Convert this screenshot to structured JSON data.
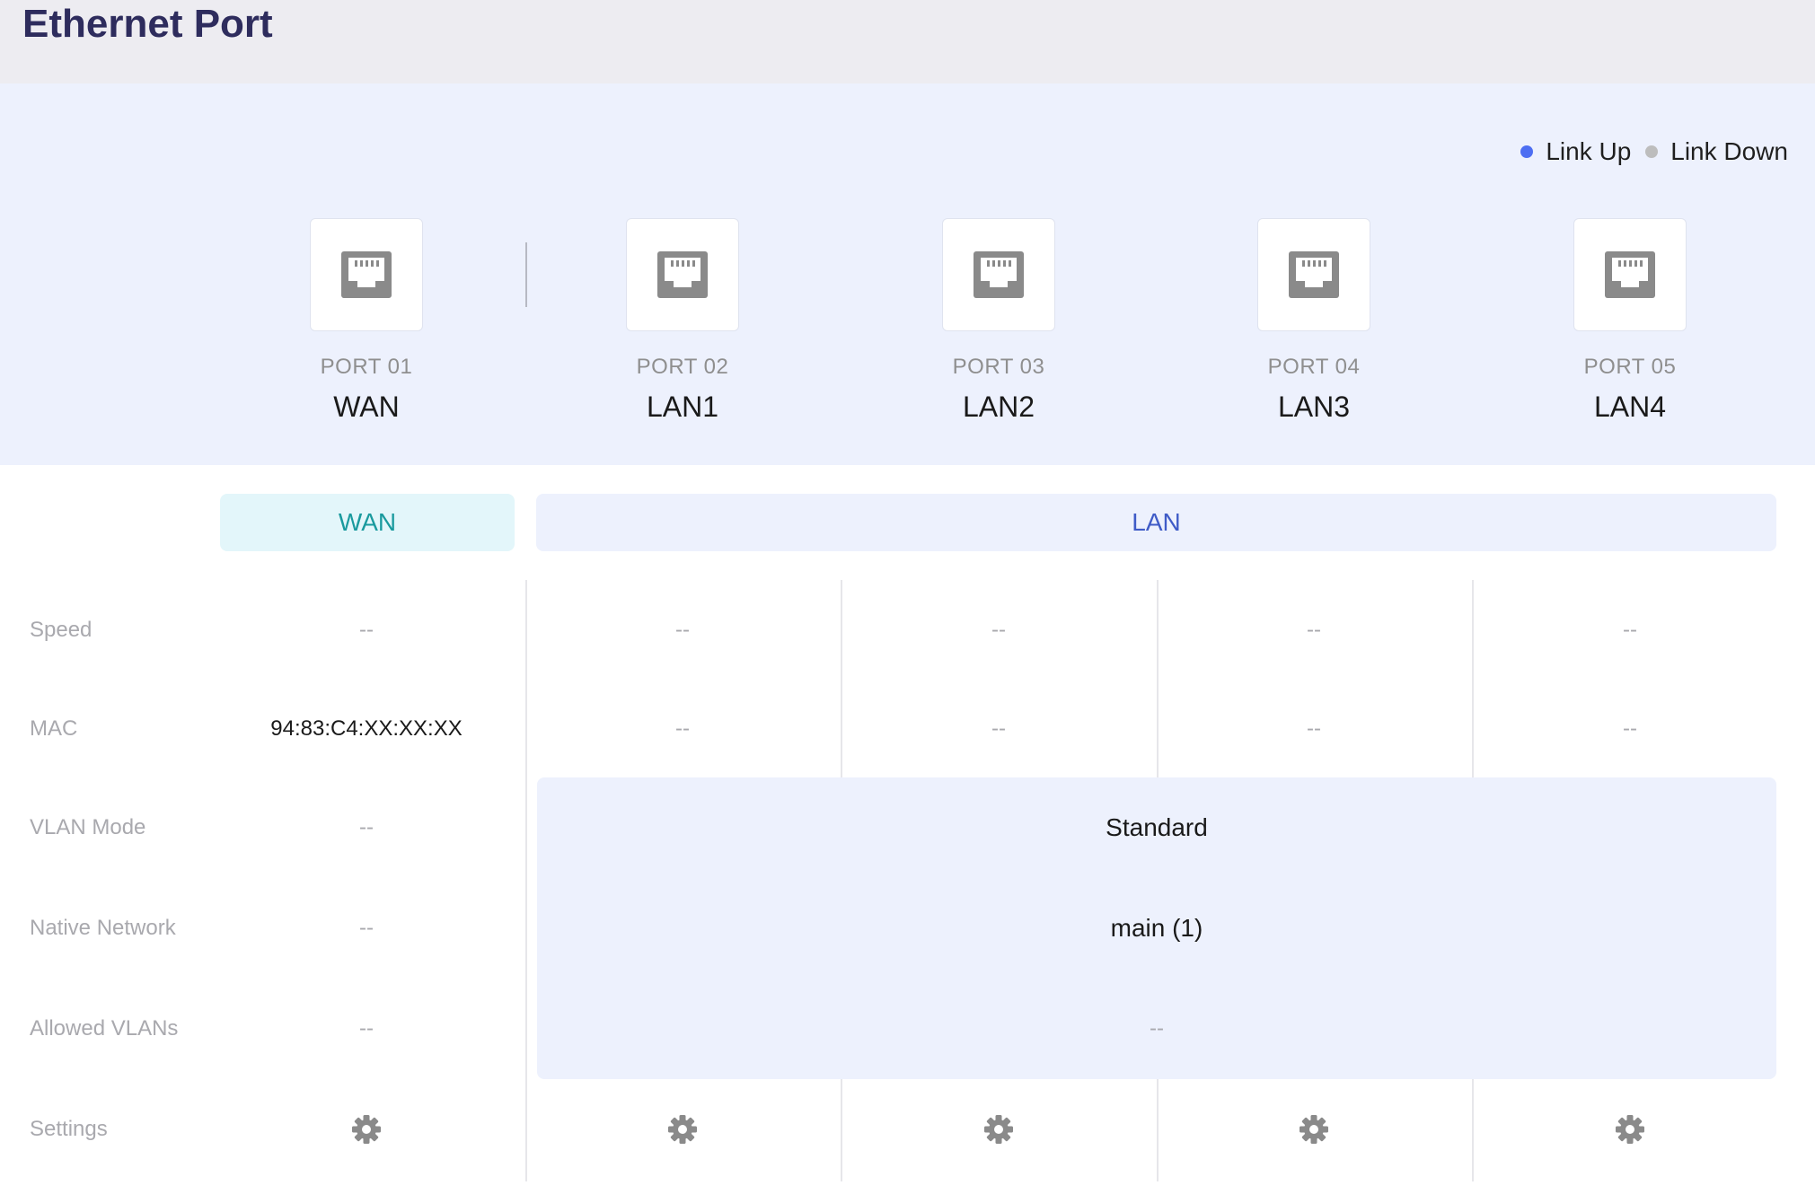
{
  "header": {
    "title": "Ethernet Port"
  },
  "legend": {
    "link_up": {
      "label": "Link Up",
      "color": "#4d6ef2"
    },
    "link_down": {
      "label": "Link Down",
      "color": "#bdbdbd"
    }
  },
  "ports": [
    {
      "number": "PORT 01",
      "name": "WAN",
      "icon": "ethernet-port-icon",
      "status": "down"
    },
    {
      "number": "PORT 02",
      "name": "LAN1",
      "icon": "ethernet-port-icon",
      "status": "down"
    },
    {
      "number": "PORT 03",
      "name": "LAN2",
      "icon": "ethernet-port-icon",
      "status": "down"
    },
    {
      "number": "PORT 04",
      "name": "LAN3",
      "icon": "ethernet-port-icon",
      "status": "down"
    },
    {
      "number": "PORT 05",
      "name": "LAN4",
      "icon": "ethernet-port-icon",
      "status": "down"
    }
  ],
  "groups": {
    "wan": "WAN",
    "lan": "LAN"
  },
  "rows": {
    "speed": {
      "label": "Speed",
      "values": [
        "--",
        "--",
        "--",
        "--",
        "--"
      ]
    },
    "mac": {
      "label": "MAC",
      "values": [
        "94:83:C4:XX:XX:XX",
        "--",
        "--",
        "--",
        "--"
      ]
    },
    "vlan_mode": {
      "label": "VLAN Mode",
      "wan": "--",
      "lan": "Standard"
    },
    "native_network": {
      "label": "Native Network",
      "wan": "--",
      "lan": "main (1)"
    },
    "allowed_vlans": {
      "label": "Allowed VLANs",
      "wan": "--",
      "lan": "--"
    },
    "settings": {
      "label": "Settings",
      "icon": "gear-icon"
    }
  },
  "colors": {
    "header_bg": "#edecf1",
    "title": "#2e2c5d",
    "panel_bg": "#edf1fd",
    "wan_accent": "#1a9a9e",
    "lan_accent": "#3f5bc7",
    "icon_gray": "#8a8a8a"
  }
}
